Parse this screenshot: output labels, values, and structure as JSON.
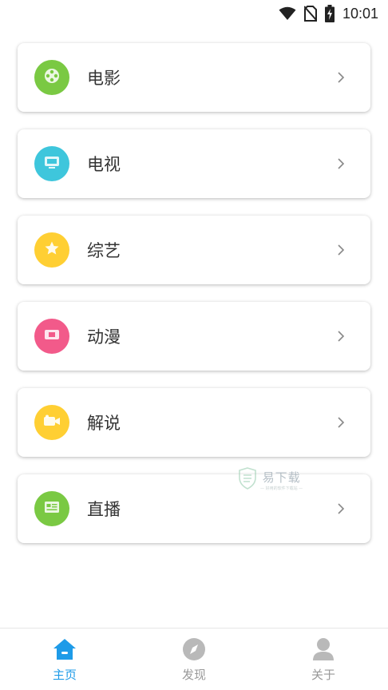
{
  "status_bar": {
    "time": "10:01",
    "icons": [
      "wifi-icon",
      "no-sim-icon",
      "battery-charging-icon"
    ]
  },
  "categories": [
    {
      "label": "电影",
      "icon": "film-reel-icon",
      "color": "#7ac943"
    },
    {
      "label": "电视",
      "icon": "tv-icon",
      "color": "#3ec6dc"
    },
    {
      "label": "综艺",
      "icon": "star-icon",
      "color": "#ffcf33"
    },
    {
      "label": "动漫",
      "icon": "ticket-icon",
      "color": "#f25a8a"
    },
    {
      "label": "解说",
      "icon": "video-camera-icon",
      "color": "#ffcf33"
    },
    {
      "label": "直播",
      "icon": "news-icon",
      "color": "#7ac943"
    }
  ],
  "watermark": {
    "main": "易下载",
    "sub": "— 好用的软件下载站 —"
  },
  "tabbar": {
    "tabs": [
      {
        "label": "主页",
        "icon": "home-icon",
        "active": true
      },
      {
        "label": "发现",
        "icon": "compass-icon",
        "active": false
      },
      {
        "label": "关于",
        "icon": "user-icon",
        "active": false
      }
    ],
    "active_color": "#1e9be8",
    "inactive_color": "#999999"
  }
}
